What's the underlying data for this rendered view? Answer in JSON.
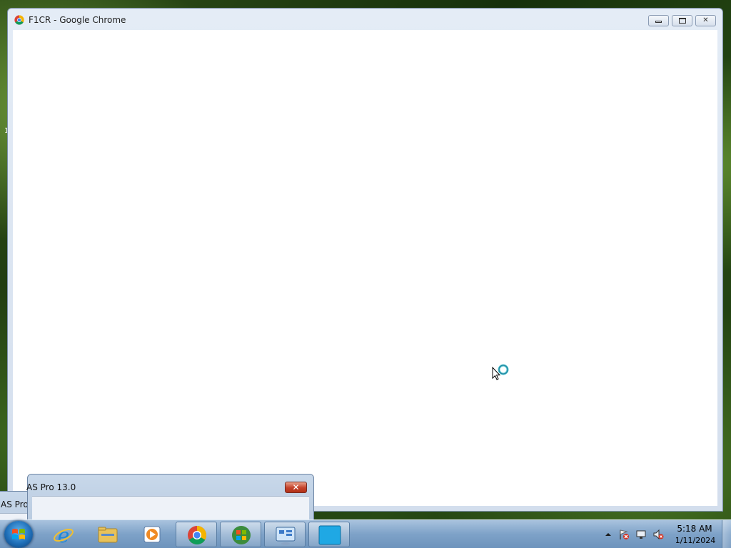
{
  "desktop": {
    "stray_text": "1"
  },
  "chrome_window": {
    "title": "F1CR - Google Chrome",
    "icon": "chrome-icon",
    "buttons": [
      "minimize",
      "maximize",
      "close"
    ]
  },
  "dialogs": [
    {
      "title": "AS Pro 13.0",
      "close_label": "✕"
    },
    {
      "title": "AS Pro 13.0",
      "close_label": "✕"
    }
  ],
  "taskbar": {
    "start": "windows-start-orb",
    "items": [
      {
        "name": "internet-explorer-icon",
        "active": false
      },
      {
        "name": "file-explorer-icon",
        "active": false
      },
      {
        "name": "media-player-icon",
        "active": false
      },
      {
        "name": "chrome-icon",
        "active": true
      },
      {
        "name": "windows-logo-app-icon",
        "active": true
      },
      {
        "name": "control-panel-icon",
        "active": true
      },
      {
        "name": "blue-window-app-icon",
        "active": true
      }
    ],
    "tray": {
      "icons": [
        "show-hidden-icons-arrow",
        "action-center-flag-icon",
        "network-icon",
        "volume-muted-icon"
      ],
      "time": "5:18 AM",
      "date": "1/11/2024"
    }
  },
  "colors": {
    "taskbar": "#7ea2c8",
    "window_frame": "#d3deed",
    "close_red": "#c4412a"
  }
}
